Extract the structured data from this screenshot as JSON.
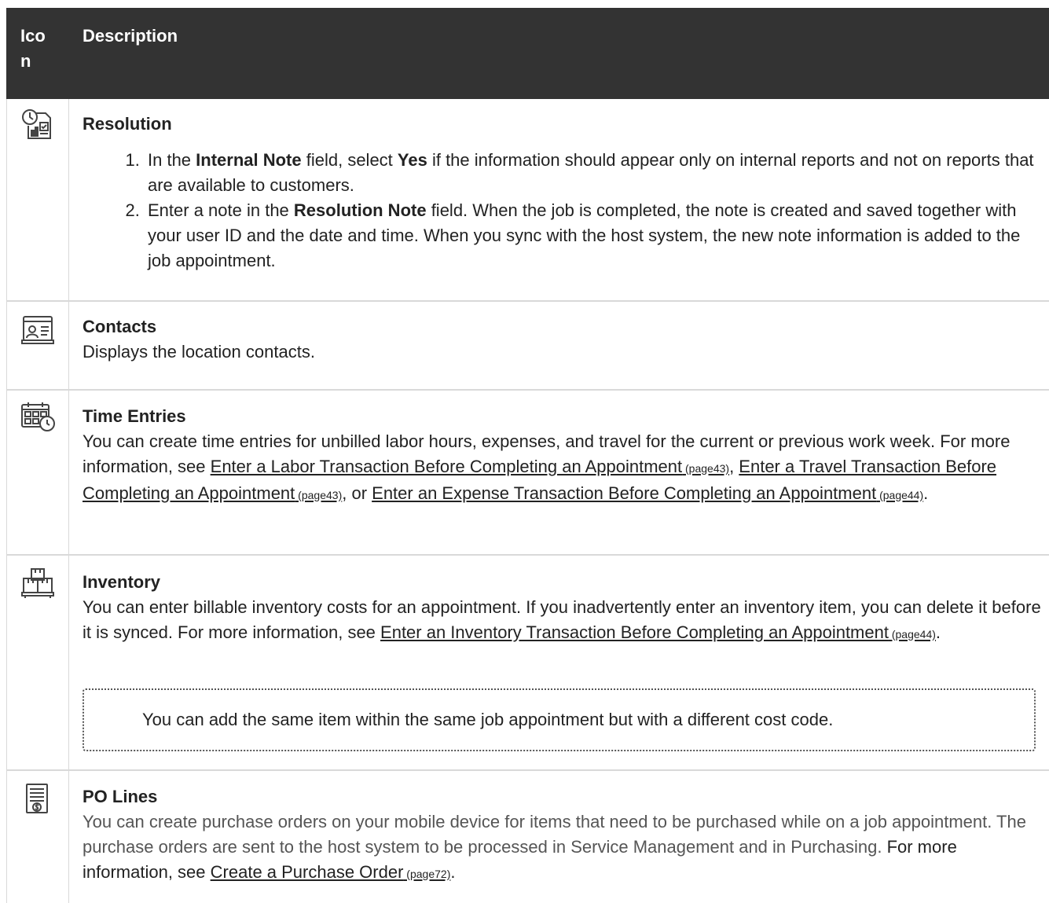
{
  "table": {
    "header": {
      "icon_col": "Ico n",
      "desc_col": "Description"
    },
    "rows": [
      {
        "icon": "resolution-icon",
        "title": "Resolution",
        "steps": [
          {
            "pre": "In the ",
            "bold1": "Internal Note",
            "mid": " field, select ",
            "bold2": "Yes",
            "post": " if the information should appear only on internal reports and not on reports that are available to customers."
          },
          {
            "pre": "Enter a note in the ",
            "bold1": "Resolution Note",
            "post": " field. When the job is completed, the note is created and saved together with your user ID and the date and time. When you sync with the host system, the new note information is added to the job appointment."
          }
        ]
      },
      {
        "icon": "contacts-icon",
        "title": "Contacts",
        "text": "Displays the location contacts."
      },
      {
        "icon": "time-entries-icon",
        "title": "Time Entries",
        "text_pre": "You can create time entries for unbilled labor hours, expenses, and travel for the current or previous work week. For more information, see ",
        "link1": "Enter a Labor Transaction Before Completing an Appointment",
        "link1_page": " (page43)",
        "sep1": ", ",
        "link2": "Enter a Travel Transaction Before Completing an Appointment",
        "link2_page": " (page43)",
        "sep2": ", or ",
        "link3": "Enter an Expense Transaction Before Completing an Appointment",
        "link3_page": " (page44)",
        "text_post": "."
      },
      {
        "icon": "inventory-icon",
        "title": "Inventory",
        "text_pre": "You can enter billable inventory costs for an appointment. If you inadvertently enter an inventory item, you can delete it before it is synced. For more information, see ",
        "link1": "Enter an Inventory Transaction Before Completing an Appointment",
        "link1_page": " (page44)",
        "text_post": ".",
        "note": "You can add the same item within the same job appointment but with a different cost code."
      },
      {
        "icon": "po-lines-icon",
        "title": "PO Lines",
        "text_grey": "You can create purchase orders on your mobile device for items that need to be purchased while on a job appointment. The purchase orders are sent to the host system to be processed in Service Management and in Purchasing.",
        "text_pre": " For more information, see ",
        "link1": "Create a Purchase Order",
        "link1_page": " (page72)",
        "text_post": "."
      }
    ]
  }
}
